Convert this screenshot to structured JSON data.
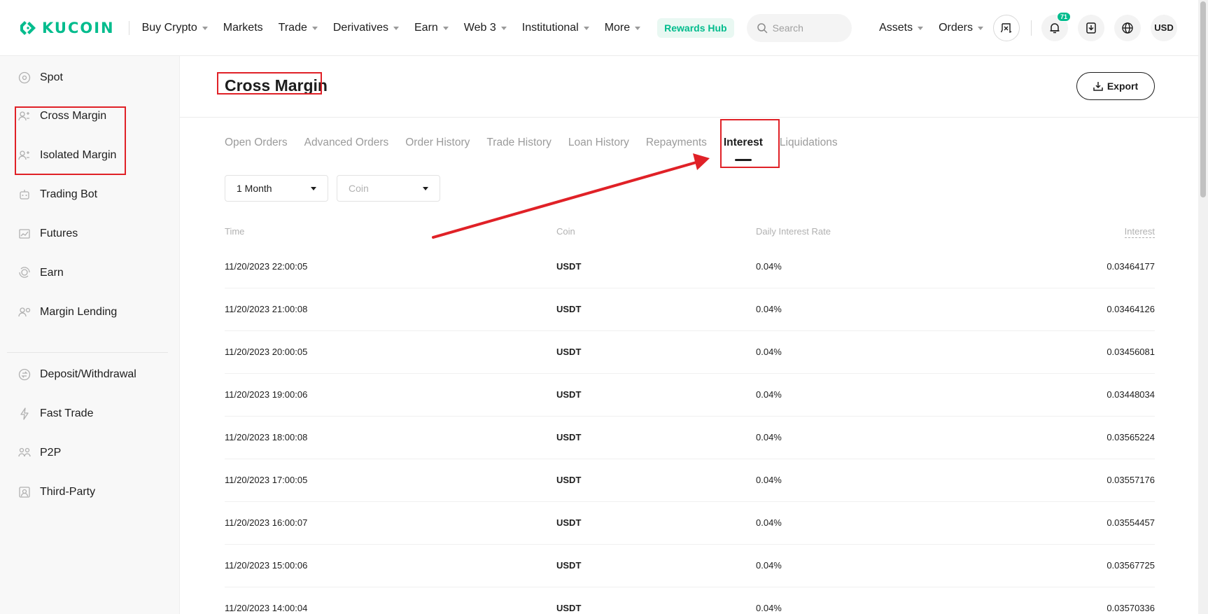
{
  "brand": {
    "name": "KUCOIN",
    "color": "#01bc8d"
  },
  "nav": {
    "items": [
      {
        "label": "Buy Crypto",
        "dropdown": true
      },
      {
        "label": "Markets",
        "dropdown": false
      },
      {
        "label": "Trade",
        "dropdown": true
      },
      {
        "label": "Derivatives",
        "dropdown": true
      },
      {
        "label": "Earn",
        "dropdown": true
      },
      {
        "label": "Web 3",
        "dropdown": true
      },
      {
        "label": "Institutional",
        "dropdown": true
      },
      {
        "label": "More",
        "dropdown": true
      }
    ],
    "rewards": "Rewards Hub",
    "search_placeholder": "Search",
    "assets": "Assets",
    "orders": "Orders",
    "notifications_count": "71",
    "currency": "USD"
  },
  "sidebar": {
    "items": [
      {
        "label": "Spot",
        "icon": "spot-icon"
      },
      {
        "label": "Cross Margin",
        "icon": "margin-icon"
      },
      {
        "label": "Isolated Margin",
        "icon": "margin-icon"
      },
      {
        "label": "Trading Bot",
        "icon": "robot-icon"
      },
      {
        "label": "Futures",
        "icon": "futures-icon"
      },
      {
        "label": "Earn",
        "icon": "earn-icon"
      },
      {
        "label": "Margin Lending",
        "icon": "lending-icon"
      },
      {
        "label": "Deposit/Withdrawal",
        "icon": "deposit-icon"
      },
      {
        "label": "Fast Trade",
        "icon": "bolt-icon"
      },
      {
        "label": "P2P",
        "icon": "p2p-icon"
      },
      {
        "label": "Third-Party",
        "icon": "third-party-icon"
      }
    ]
  },
  "main": {
    "title": "Cross Margin",
    "export_label": "Export",
    "tabs": [
      "Open Orders",
      "Advanced Orders",
      "Order History",
      "Trade History",
      "Loan History",
      "Repayments",
      "Interest",
      "Liquidations"
    ],
    "active_tab": "Interest",
    "filters": {
      "period": "1 Month",
      "coin_placeholder": "Coin"
    },
    "columns": {
      "time": "Time",
      "coin": "Coin",
      "rate": "Daily Interest Rate",
      "interest": "Interest"
    },
    "rows": [
      {
        "time": "11/20/2023 22:00:05",
        "coin": "USDT",
        "rate": "0.04%",
        "interest": "0.03464177"
      },
      {
        "time": "11/20/2023 21:00:08",
        "coin": "USDT",
        "rate": "0.04%",
        "interest": "0.03464126"
      },
      {
        "time": "11/20/2023 20:00:05",
        "coin": "USDT",
        "rate": "0.04%",
        "interest": "0.03456081"
      },
      {
        "time": "11/20/2023 19:00:06",
        "coin": "USDT",
        "rate": "0.04%",
        "interest": "0.03448034"
      },
      {
        "time": "11/20/2023 18:00:08",
        "coin": "USDT",
        "rate": "0.04%",
        "interest": "0.03565224"
      },
      {
        "time": "11/20/2023 17:00:05",
        "coin": "USDT",
        "rate": "0.04%",
        "interest": "0.03557176"
      },
      {
        "time": "11/20/2023 16:00:07",
        "coin": "USDT",
        "rate": "0.04%",
        "interest": "0.03554457"
      },
      {
        "time": "11/20/2023 15:00:06",
        "coin": "USDT",
        "rate": "0.04%",
        "interest": "0.03567725"
      },
      {
        "time": "11/20/2023 14:00:04",
        "coin": "USDT",
        "rate": "0.04%",
        "interest": "0.03570336"
      }
    ]
  },
  "annotation_color": "#e02127"
}
